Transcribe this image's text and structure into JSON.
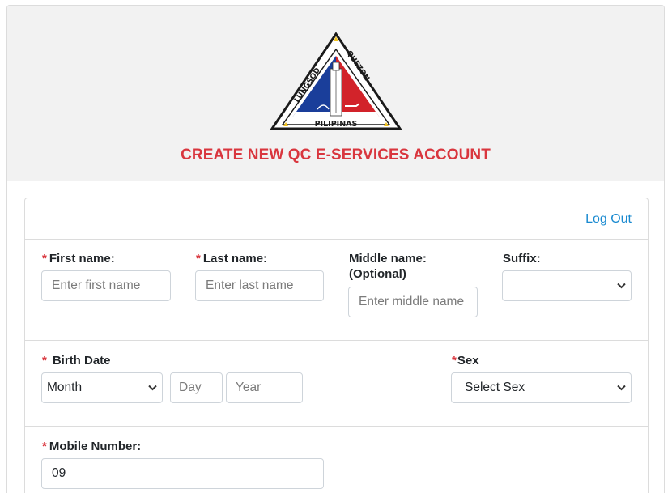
{
  "header": {
    "title": "CREATE NEW QC E-SERVICES ACCOUNT",
    "logo_text": {
      "left": "LUNGSOD",
      "right": "QUEZON",
      "bottom": "PILIPINAS"
    },
    "colors": {
      "title": "#d9363e",
      "logo_blue": "#1a3e9a",
      "logo_red": "#d2232a",
      "logo_star": "#f2c21b"
    }
  },
  "nav": {
    "logout_label": "Log Out"
  },
  "form": {
    "first_name": {
      "label": "First name:",
      "required": "*",
      "placeholder": "Enter first name",
      "value": ""
    },
    "last_name": {
      "label": "Last name:",
      "required": "*",
      "placeholder": "Enter last name",
      "value": ""
    },
    "middle_name": {
      "label_line1": "Middle name:",
      "label_line2": "(Optional)",
      "placeholder": "Enter middle name",
      "value": ""
    },
    "suffix": {
      "label": "Suffix:",
      "selected": ""
    },
    "birth_date": {
      "label": "Birth Date",
      "required": "*",
      "month_selected": "Month",
      "day_placeholder": "Day",
      "year_placeholder": "Year"
    },
    "sex": {
      "label": "Sex",
      "required": "*",
      "selected": "Select Sex"
    },
    "mobile": {
      "label": "Mobile Number:",
      "required": "*",
      "value": "09"
    }
  },
  "icons": {
    "select_arrow": "chevron-down-icon"
  }
}
